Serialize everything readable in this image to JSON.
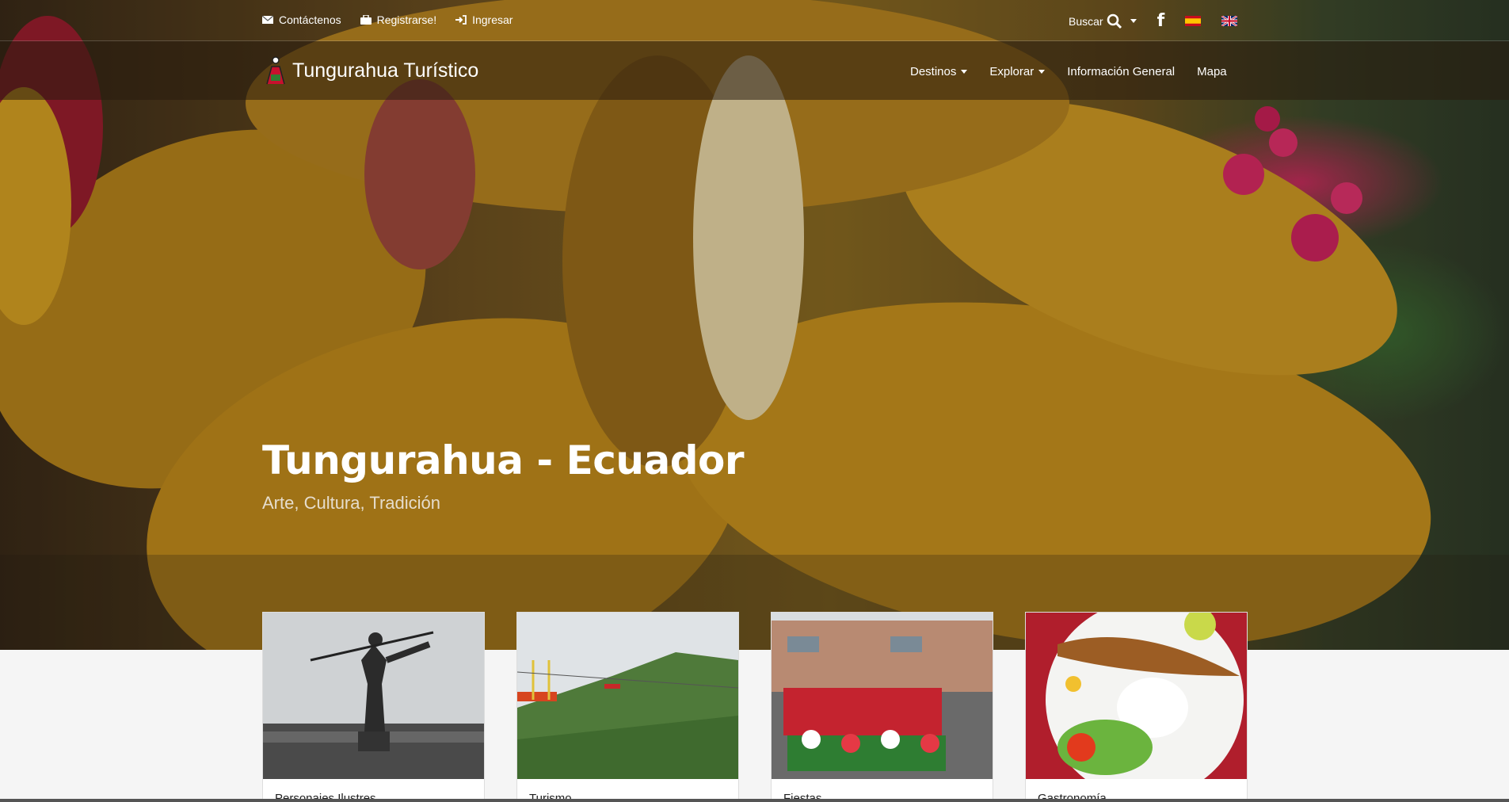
{
  "topbar": {
    "links": [
      {
        "label": "Contáctenos",
        "icon": "envelope-icon"
      },
      {
        "label": "Registrarse!",
        "icon": "briefcase-icon"
      },
      {
        "label": "Ingresar",
        "icon": "sign-in-icon"
      }
    ],
    "search_label": "Buscar",
    "facebook_glyph": "f"
  },
  "navbar": {
    "brand": "Tungurahua Turístico",
    "items": [
      {
        "label": "Destinos",
        "dropdown": true
      },
      {
        "label": "Explorar",
        "dropdown": true
      },
      {
        "label": "Información General",
        "dropdown": false
      },
      {
        "label": "Mapa",
        "dropdown": false
      }
    ]
  },
  "hero": {
    "title": "Tungurahua - Ecuador",
    "subtitle": "Arte, Cultura, Tradición"
  },
  "cards": [
    {
      "label": "Personajes Ilustres"
    },
    {
      "label": "Turismo"
    },
    {
      "label": "Fiestas"
    },
    {
      "label": "Gastronomía"
    }
  ],
  "colors": {
    "petal": "#c9921a",
    "accent_pink": "#d8285f",
    "foliage": "#3d6b2f"
  }
}
